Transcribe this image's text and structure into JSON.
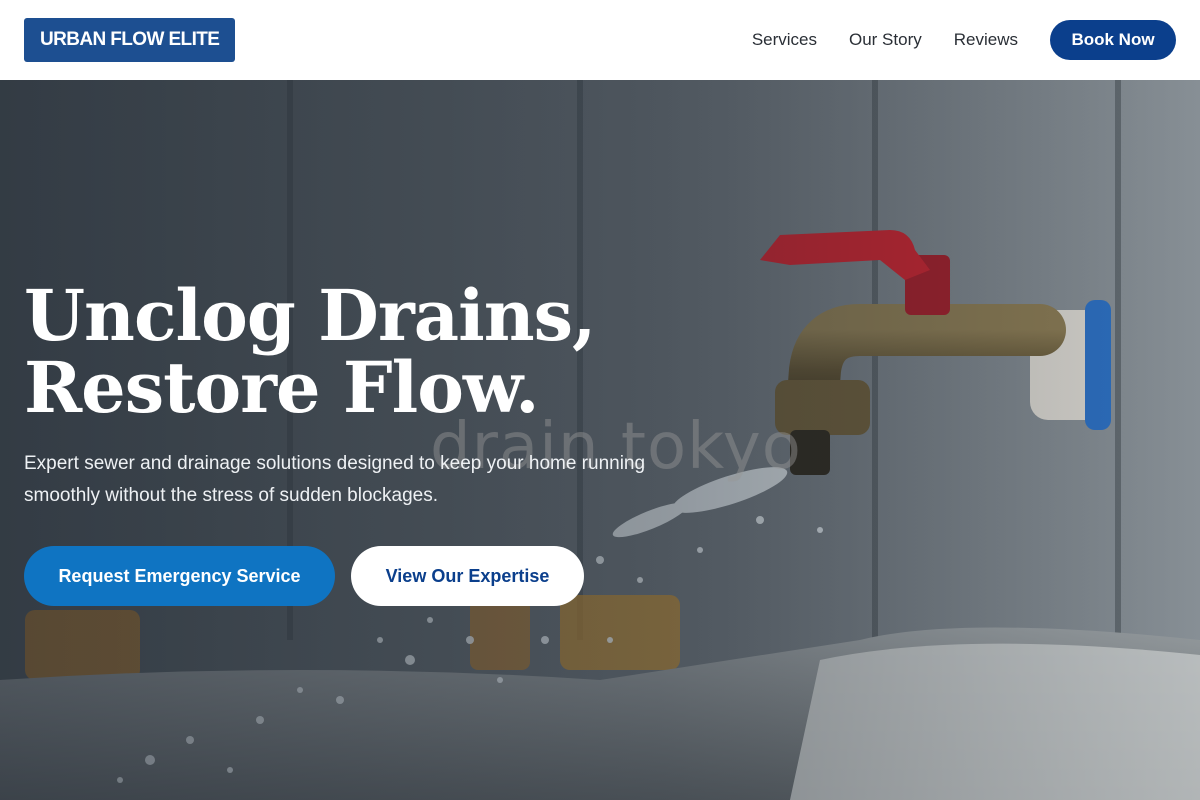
{
  "header": {
    "logo_text": "URBAN FLOW ELITE",
    "nav": [
      {
        "label": "Services"
      },
      {
        "label": "Our Story"
      },
      {
        "label": "Reviews"
      }
    ],
    "cta_label": "Book Now"
  },
  "hero": {
    "title_line1": "Unclog Drains,",
    "title_line2": "Restore Flow.",
    "subtitle": "Expert sewer and drainage solutions designed to keep your home running smoothly without the stress of sudden blockages.",
    "primary_button": "Request Emergency Service",
    "secondary_button": "View Our Expertise",
    "watermark": "drain tokyo"
  },
  "colors": {
    "brand": "#1d4f91",
    "cta_navy": "#0b3f8c",
    "primary_blue": "#0f74c2",
    "faucet_handle": "#c4232f"
  },
  "icons": {
    "hero_image": "faucet-with-running-water"
  }
}
